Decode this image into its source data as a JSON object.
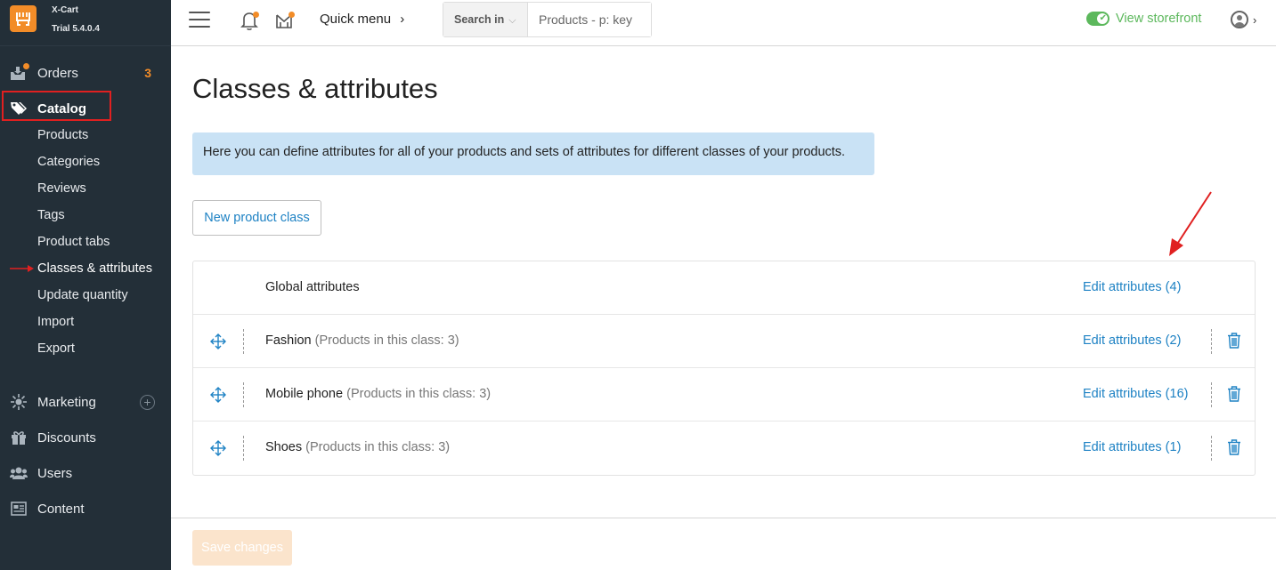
{
  "brand": {
    "name": "X-Cart",
    "version": "Trial 5.4.0.4"
  },
  "sidebar": {
    "items": [
      {
        "label": "Orders",
        "badge": "3"
      },
      {
        "label": "Catalog"
      },
      {
        "label": "Marketing"
      },
      {
        "label": "Discounts"
      },
      {
        "label": "Users"
      },
      {
        "label": "Content"
      }
    ],
    "catalog_sub": [
      {
        "label": "Products"
      },
      {
        "label": "Categories"
      },
      {
        "label": "Reviews"
      },
      {
        "label": "Tags"
      },
      {
        "label": "Product tabs"
      },
      {
        "label": "Classes & attributes"
      },
      {
        "label": "Update quantity"
      },
      {
        "label": "Import"
      },
      {
        "label": "Export"
      }
    ]
  },
  "header": {
    "quick_menu": "Quick menu",
    "search_in": "Search in",
    "search_placeholder": "Products - p: key",
    "view_storefront": "View storefront"
  },
  "main": {
    "title": "Classes & attributes",
    "info": "Here you can define attributes for all of your products and sets of attributes for different classes of your products.",
    "new_class_button": "New product class",
    "rows": [
      {
        "name": "Global attributes",
        "detail": "",
        "edit": "Edit attributes (4)"
      },
      {
        "name": "Fashion",
        "detail": "(Products in this class: 3)",
        "edit": "Edit attributes (2)"
      },
      {
        "name": "Mobile phone",
        "detail": "(Products in this class: 3)",
        "edit": "Edit attributes (16)"
      },
      {
        "name": "Shoes",
        "detail": "(Products in this class: 3)",
        "edit": "Edit attributes (1)"
      }
    ],
    "save_button": "Save changes"
  },
  "colors": {
    "sidebar_bg": "#232f38",
    "accent_orange": "#f28c28",
    "link_blue": "#1e82c4",
    "storefront_green": "#5cb85c",
    "annotation_red": "#e02020",
    "info_bg": "#c9e2f5"
  }
}
